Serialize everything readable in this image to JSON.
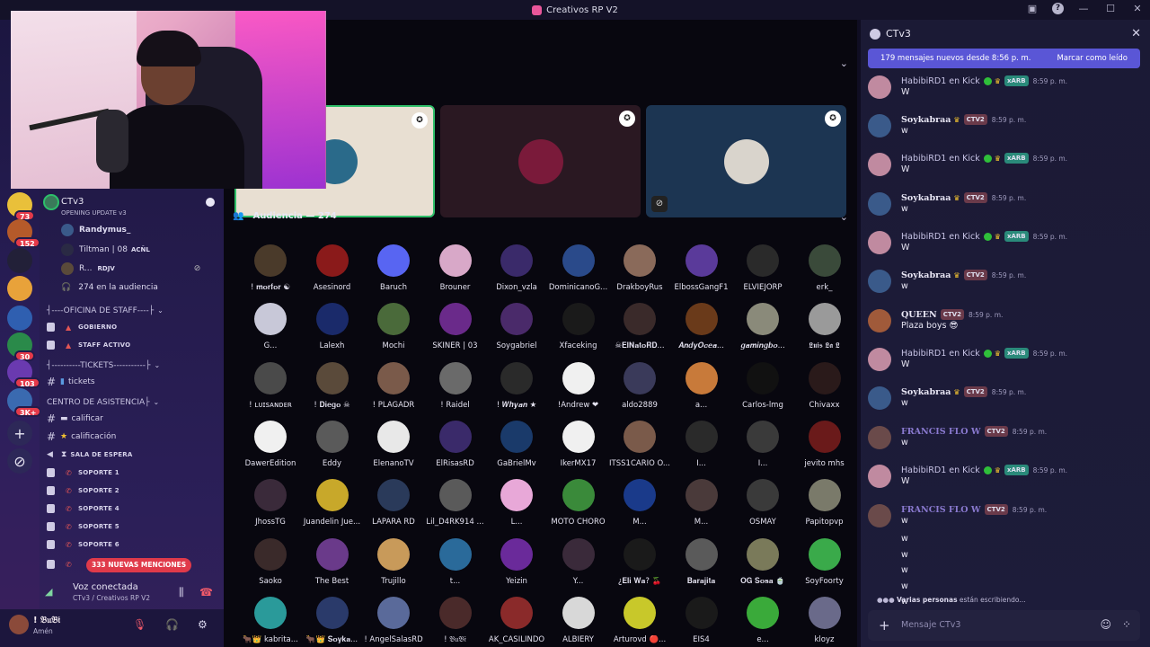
{
  "window": {
    "title": "Creativos RP V2"
  },
  "rail": {
    "servers": [
      {
        "color": "#e9c03a",
        "badge": "73"
      },
      {
        "color": "#b55a2a",
        "badge": "152"
      },
      {
        "color": "#222038",
        "badge": ""
      },
      {
        "color": "#e8a23a",
        "badge": ""
      },
      {
        "color": "#2f5fb0",
        "badge": ""
      },
      {
        "color": "#2a8a4a",
        "badge": "30"
      },
      {
        "color": "#6a3ab0",
        "badge": "103"
      },
      {
        "color": "#3a6ab0",
        "badge": "3K+"
      }
    ]
  },
  "voice_channel": {
    "name": "CTv3",
    "subtitle": "OPENING UPDATE v3",
    "members": [
      {
        "name": "Randymus_",
        "bold": true,
        "color": "#3a5a8a"
      },
      {
        "name": "Tiltman | 08",
        "tag": "ACÑL",
        "color": "#2a2a44"
      },
      {
        "name": "R...",
        "tag": "RDJV",
        "color": "#5a4a3a"
      }
    ],
    "audience_label": "274 en la audiencia"
  },
  "categories": {
    "staff": "┤----OFICINA DE STAFF----├",
    "tickets": "┤----------TICKETS-----------├",
    "asistencia": "CENTRO DE ASISTENCIA├"
  },
  "channels": {
    "gobierno": "GOBIERNO",
    "staff_activo": "STAFF ACTIVO",
    "tickets": "tickets",
    "calificar": "calificar",
    "calificacion": "calificación",
    "sala_espera": "SALA DE ESPERA",
    "soporte1": "SOPORTE 1",
    "soporte2": "SOPORTE 2",
    "soporte4": "SOPORTE 4",
    "soporte5": "SOPORTE 5",
    "soporte6": "SOPORTE 6"
  },
  "mentions_pill": "333 NUEVAS MENCIONES",
  "voice_status": {
    "title": "Voz conectada",
    "sub": "CTv3 / Creativos RP V2"
  },
  "user": {
    "name": "! 𝔅𝔲𝔅𝔦",
    "status": "Amén"
  },
  "stage": {
    "audience_header": "Audiencia — 274"
  },
  "audience": [
    [
      "! 𝐦𝐨𝐫𝐟𝐨𝐫 ☯",
      "#4a3a2a"
    ],
    [
      "Asesinord",
      "#8a1a1a"
    ],
    [
      "Baruch",
      "#5865f2"
    ],
    [
      "Brouner",
      "#d8a8c8"
    ],
    [
      "Dixon_vzla",
      "#3a2a6a"
    ],
    [
      "DominicanoG...",
      "#2a4a8a"
    ],
    [
      "DrakboyRus",
      "#8a6a5a"
    ],
    [
      "ElbossGangF1",
      "#5a3a9a"
    ],
    [
      "ELVIEJORP",
      "#2a2a2a"
    ],
    [
      "erk_",
      "#3a4a3a"
    ],
    [
      "G...",
      "#c8c8d8"
    ],
    [
      "Lalexh",
      "#1a2a6a"
    ],
    [
      "Mochi",
      "#4a6a3a"
    ],
    [
      "SKINER | 03",
      "#6a2a8a"
    ],
    [
      "Soygabriel",
      "#4a2a6a"
    ],
    [
      "Xfaceking",
      "#1a1a1a"
    ],
    [
      "☠𝐄𝐥𝐍𝐚𝐭𝐨𝐑𝐃...",
      "#3a2a2a"
    ],
    [
      "𝑨𝒏𝒅𝒚𝑶𝒄𝒆𝒂...",
      "#6a3a1a"
    ],
    [
      "𝒈𝒂𝒎𝒊𝒏𝒈𝒃𝒐...",
      "#8a8a7a"
    ],
    [
      "𝕷𝖚𝖎𝖘 𝕷𝖆 𝕷",
      "#9a9a9a"
    ],
    [
      "! ʟᴜɪsᴀɴᴅᴇʀ",
      "#4a4a4a"
    ],
    [
      "! 𝐃𝐢𝐞𝐠𝐨 ☠",
      "#5a4a3a"
    ],
    [
      "! PLAGADR",
      "#7a5a4a"
    ],
    [
      "! Raidel",
      "#6a6a6a"
    ],
    [
      "! 𝑾𝒉𝒚𝒂𝒏 ★",
      "#2a2a2a"
    ],
    [
      "!Andrew ❤",
      "#f0f0f0"
    ],
    [
      "aldo2889",
      "#3a3a5a"
    ],
    [
      "a...",
      "#c87a3a"
    ],
    [
      "Carlos-lmg",
      "#111111"
    ],
    [
      "Chivaxx",
      "#2a1a1a"
    ],
    [
      "DawerEdition",
      "#f0f0f0"
    ],
    [
      "Eddy",
      "#5a5a5a"
    ],
    [
      "ElenanoTV",
      "#e8e8e8"
    ],
    [
      "ElRisasRD",
      "#3a2a6a"
    ],
    [
      "GaBrielMv",
      "#1a3a6a"
    ],
    [
      "IkerMX17",
      "#f0f0f0"
    ],
    [
      "ITSS1CARIO O...",
      "#7a5a4a"
    ],
    [
      "I...",
      "#2a2a2a"
    ],
    [
      "I...",
      "#3a3a3a"
    ],
    [
      "jevito mhs",
      "#6a1a1a"
    ],
    [
      "JhossTG",
      "#3a2a3a"
    ],
    [
      "Juandelin Jue...",
      "#c8a82a"
    ],
    [
      "LAPARA RD",
      "#2a3a5a"
    ],
    [
      "Lil_D4RK914 ...",
      "#5a5a5a"
    ],
    [
      "L...",
      "#e8a8d8"
    ],
    [
      "MOTO CHORO",
      "#3a8a3a"
    ],
    [
      "M...",
      "#1a3a8a"
    ],
    [
      "M...",
      "#4a3a3a"
    ],
    [
      "OSMAY",
      "#3a3a3a"
    ],
    [
      "Papitopvp",
      "#7a7a6a"
    ],
    [
      "Saoko",
      "#3a2a2a"
    ],
    [
      "The Best",
      "#6a3a8a"
    ],
    [
      "Trujillo",
      "#c89a5a"
    ],
    [
      "t...",
      "#2a6a9a"
    ],
    [
      "Yeizin",
      "#6a2a9a"
    ],
    [
      "Y...",
      "#3a2a3a"
    ],
    [
      "¿𝐄𝐥𝐢 𝐖𝐚? 🍒",
      "#1a1a1a"
    ],
    [
      "𝐁𝐚𝐫𝐚𝐣𝐢𝐭𝐚",
      "#5a5a5a"
    ],
    [
      "𝐎𝐆 𝐒𝐨𝐬𝐚 🍵",
      "#7a7a5a"
    ],
    [
      "SoyFoorty",
      "#3aaa4a"
    ],
    [
      "🐂👑 kabrita...",
      "#2a9a9a"
    ],
    [
      "🐂👑 𝐒𝐨𝐲𝐤𝐚...",
      "#2a3a6a"
    ],
    [
      "! AngelSalasRD",
      "#5a6a9a"
    ],
    [
      "! 𝔅𝔲𝔅𝔦",
      "#4a2a2a"
    ],
    [
      "AK_CASILINDO",
      "#8a2a2a"
    ],
    [
      "ALBIERY",
      "#d8d8d8"
    ],
    [
      "Arturovd 🔴...",
      "#c8c82a"
    ],
    [
      "EIS4",
      "#1a1a1a"
    ],
    [
      "e...",
      "#3aaa3a"
    ],
    [
      "kloyz",
      "#6a6a8a"
    ]
  ],
  "chat": {
    "title": "CTv3",
    "new_bar_left": "179 mensajes nuevos desde 8:56 p. m.",
    "new_bar_right": "Marcar como leído",
    "messages": [
      {
        "name": "HabibiRD1 en Kick",
        "style": "habibi",
        "tag": "xARB",
        "time": "8:59 p. m.",
        "text": "W"
      },
      {
        "name": "𝐒𝐨𝐲𝐤𝐚𝐛𝐫𝐚𝐚",
        "style": "soy",
        "tag": "CTV2",
        "time": "8:59 p. m.",
        "text": "w"
      },
      {
        "name": "HabibiRD1 en Kick",
        "style": "habibi",
        "tag": "xARB",
        "time": "8:59 p. m.",
        "text": "W"
      },
      {
        "name": "𝐒𝐨𝐲𝐤𝐚𝐛𝐫𝐚𝐚",
        "style": "soy",
        "tag": "CTV2",
        "time": "8:59 p. m.",
        "text": "w"
      },
      {
        "name": "HabibiRD1 en Kick",
        "style": "habibi",
        "tag": "xARB",
        "time": "8:59 p. m.",
        "text": "W"
      },
      {
        "name": "𝐒𝐨𝐲𝐤𝐚𝐛𝐫𝐚𝐚",
        "style": "soy",
        "tag": "CTV2",
        "time": "8:59 p. m.",
        "text": "w"
      },
      {
        "name": "𝐐𝐔𝐄𝐄𝐍",
        "style": "queen",
        "tag": "CTV2",
        "time": "8:59 p. m.",
        "text": "Plaza boys 😎"
      },
      {
        "name": "HabibiRD1 en Kick",
        "style": "habibi",
        "tag": "xARB",
        "time": "8:59 p. m.",
        "text": "W"
      },
      {
        "name": "𝐒𝐨𝐲𝐤𝐚𝐛𝐫𝐚𝐚",
        "style": "soy",
        "tag": "CTV2",
        "time": "8:59 p. m.",
        "text": "w"
      },
      {
        "name": "FRANCIS FLO W",
        "style": "francis",
        "tag": "CTV2",
        "time": "8:59 p. m.",
        "text": "w"
      },
      {
        "name": "HabibiRD1 en Kick",
        "style": "habibi",
        "tag": "xARB",
        "time": "8:59 p. m.",
        "text": "W"
      },
      {
        "name": "FRANCIS FLO W",
        "style": "francis",
        "tag": "CTV2",
        "time": "8:59 p. m.",
        "text": "w"
      }
    ],
    "extra_lines": [
      "w",
      "w",
      "w",
      "w",
      "w"
    ],
    "typing_who": "Varias personas",
    "typing_rest": "están escribiendo...",
    "input_placeholder": "Mensaje CTv3"
  }
}
